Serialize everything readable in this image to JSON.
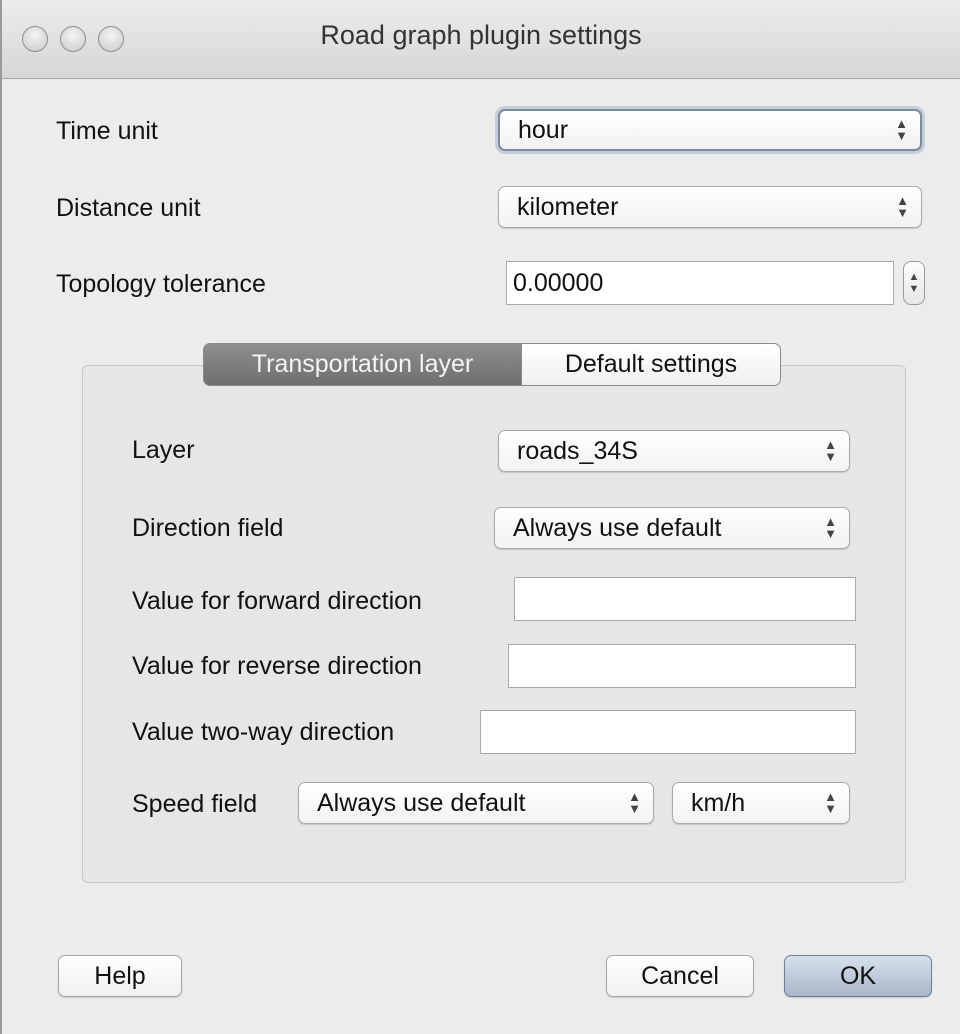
{
  "window": {
    "title": "Road graph plugin settings"
  },
  "fields": {
    "time_unit": {
      "label": "Time unit",
      "value": "hour"
    },
    "distance_unit": {
      "label": "Distance unit",
      "value": "kilometer"
    },
    "topology_tolerance": {
      "label": "Topology tolerance",
      "value": "0.00000"
    }
  },
  "tabs": [
    {
      "label": "Transportation layer",
      "active": true
    },
    {
      "label": "Default settings",
      "active": false
    }
  ],
  "transport": {
    "layer": {
      "label": "Layer",
      "value": "roads_34S"
    },
    "direction_field": {
      "label": "Direction field",
      "value": "Always use default"
    },
    "forward": {
      "label": "Value for forward direction",
      "value": ""
    },
    "reverse": {
      "label": "Value for reverse direction",
      "value": ""
    },
    "two_way": {
      "label": "Value two-way direction",
      "value": ""
    },
    "speed_field": {
      "label": "Speed field",
      "value": "Always use default"
    },
    "speed_unit": {
      "value": "km/h"
    }
  },
  "buttons": {
    "help": "Help",
    "cancel": "Cancel",
    "ok": "OK"
  },
  "icons": {
    "combo_arrows": "updown-arrows-icon",
    "spinner": "spinner-arrows-icon"
  }
}
